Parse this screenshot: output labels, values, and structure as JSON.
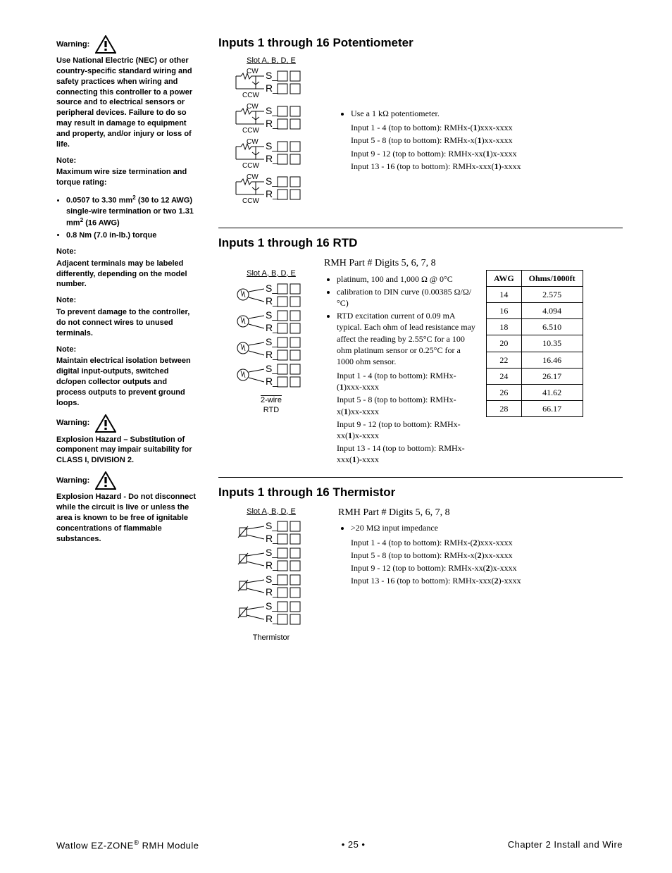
{
  "sidebar": {
    "warning1": {
      "label": "Warning:",
      "text": "Use National Electric (NEC) or other country-specific standard wiring and safety practices when wiring and connecting this controller to a power source and to electrical sensors or peripheral devices. Failure to do so may result in damage to equipment and property, and/or injury or loss of life."
    },
    "note1": {
      "label": "Note:",
      "text": "Maximum wire size termination and torque rating:",
      "bullets": [
        "0.0507 to 3.30 mm² (30 to 12 AWG) single-wire termination or two 1.31 mm² (16 AWG)",
        "0.8 Nm (7.0 in-lb.) torque"
      ]
    },
    "note2": {
      "label": "Note:",
      "text": "Adjacent terminals may be labeled differently, depending on the model number."
    },
    "note3": {
      "label": "Note:",
      "text": "To prevent damage to the controller, do not connect wires to unused terminals."
    },
    "note4": {
      "label": "Note:",
      "text": "Maintain electrical isolation between digital input-outputs, switched dc/open collector outputs and process outputs to prevent ground loops."
    },
    "warning2": {
      "label": "Warning:",
      "text": "Explosion Hazard – Substitution of component may impair suitability for CLASS I, DIVISION 2."
    },
    "warning3": {
      "label": "Warning:",
      "text": "Explosion Hazard - Do not disconnect while the circuit is live or unless the area is known to be free of ignitable concentrations of flammable substances."
    }
  },
  "sections": {
    "pot": {
      "title": "Inputs 1 through 16 Potentiometer",
      "slot_label": "Slot A, B, D, E",
      "bullets": {
        "lead": "Use a 1 kΩ potentiometer.",
        "items": [
          "Input 1 - 4 (top to bottom): RMHx-(1)xxx-xxxx",
          "Input 5 - 8 (top to bottom): RMHx-x(1)xx-xxxx",
          "Input 9 - 12 (top to bottom): RMHx-xx(1)x-xxxx",
          "Input 13 - 16 (top to bottom): RMHx-xxx(1)-xxxx"
        ]
      }
    },
    "rtd": {
      "title": "Inputs 1 through 16 RTD",
      "subheading": "RMH Part # Digits 5, 6, 7, 8",
      "slot_label": "Slot A, B, D, E",
      "caption1": "2-wire",
      "caption2": "RTD",
      "bullets": [
        "platinum, 100 and 1,000 Ω @ 0°C",
        "calibration to DIN curve (0.00385 Ω/Ω/°C)",
        "RTD excitation current of 0.09 mA typical. Each ohm of lead resistance may affect the reading by 2.55°C for a 100 ohm platinum sensor or 0.25°C for a 1000 ohm sensor."
      ],
      "items": [
        "Input 1 - 4 (top to bottom): RMHx-(1)xxx-xxxx",
        "Input 5 - 8 (top to bottom): RMHx-x(1)xx-xxxx",
        "Input 9 - 12 (top to bottom): RMHx-xx(1)x-xxxx",
        "Input 13 - 14 (top to bottom): RMHx-xxx(1)-xxxx"
      ],
      "table": {
        "headers": [
          "AWG",
          "Ohms/1000ft"
        ],
        "rows": [
          [
            "14",
            "2.575"
          ],
          [
            "16",
            "4.094"
          ],
          [
            "18",
            "6.510"
          ],
          [
            "20",
            "10.35"
          ],
          [
            "22",
            "16.46"
          ],
          [
            "24",
            "26.17"
          ],
          [
            "26",
            "41.62"
          ],
          [
            "28",
            "66.17"
          ]
        ]
      }
    },
    "therm": {
      "title": "Inputs 1 through 16 Thermistor",
      "subheading": "RMH Part # Digits 5, 6, 7, 8",
      "slot_label": "Slot A, B, D, E",
      "caption": "Thermistor",
      "bullets": {
        "lead": ">20 MΩ input impedance",
        "items": [
          "Input 1 - 4 (top to bottom): RMHx-(2)xxx-xxxx",
          "Input 5 - 8 (top to bottom): RMHx-x(2)xx-xxxx",
          "Input 9 - 12 (top to bottom): RMHx-xx(2)x-xxxx",
          "Input 13 - 16 (top to bottom): RMHx-xxx(2)-xxxx"
        ]
      }
    }
  },
  "footer": {
    "left": "Watlow EZ-ZONE® RMH Module",
    "center": "•  25  •",
    "right": "Chapter 2 Install and Wire"
  },
  "diagram_labels": {
    "cw": "CW",
    "ccw": "CCW",
    "s": "S_",
    "r": "R_"
  }
}
